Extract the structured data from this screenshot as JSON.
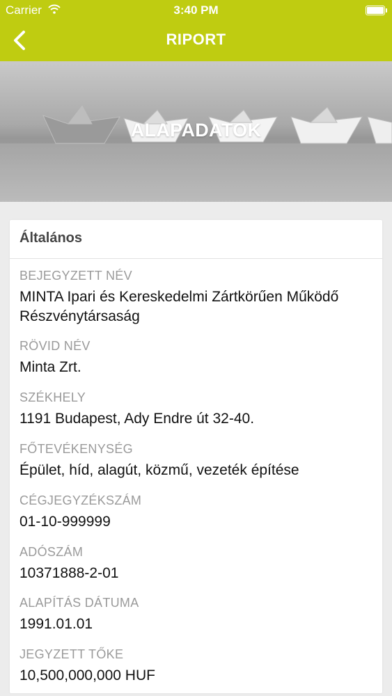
{
  "status_bar": {
    "carrier": "Carrier",
    "time": "3:40 PM"
  },
  "nav": {
    "title": "RIPORT"
  },
  "hero": {
    "title": "ALAPADATOK"
  },
  "card": {
    "header": "Általános",
    "fields": [
      {
        "label": "BEJEGYZETT NÉV",
        "value": "MINTA Ipari és Kereskedelmi Zártkörűen Működő Részvénytársaság"
      },
      {
        "label": "RÖVID NÉV",
        "value": "Minta Zrt."
      },
      {
        "label": "SZÉKHELY",
        "value": "1191 Budapest, Ady Endre út 32-40."
      },
      {
        "label": "FŐTEVÉKENYSÉG",
        "value": "Épület, híd, alagút, közmű, vezeték építése"
      },
      {
        "label": "CÉGJEGYZÉKSZÁM",
        "value": "01-10-999999"
      },
      {
        "label": "ADÓSZÁM",
        "value": "10371888-2-01"
      },
      {
        "label": "ALAPÍTÁS DÁTUMA",
        "value": "1991.01.01"
      },
      {
        "label": "JEGYZETT TŐKE",
        "value": "10,500,000,000 HUF"
      }
    ]
  },
  "colors": {
    "accent": "#bfcc11",
    "label": "#9a9a9a",
    "value": "#111111"
  },
  "icons": {
    "back": "chevron-left-icon",
    "wifi": "wifi-icon",
    "battery": "battery-icon"
  }
}
